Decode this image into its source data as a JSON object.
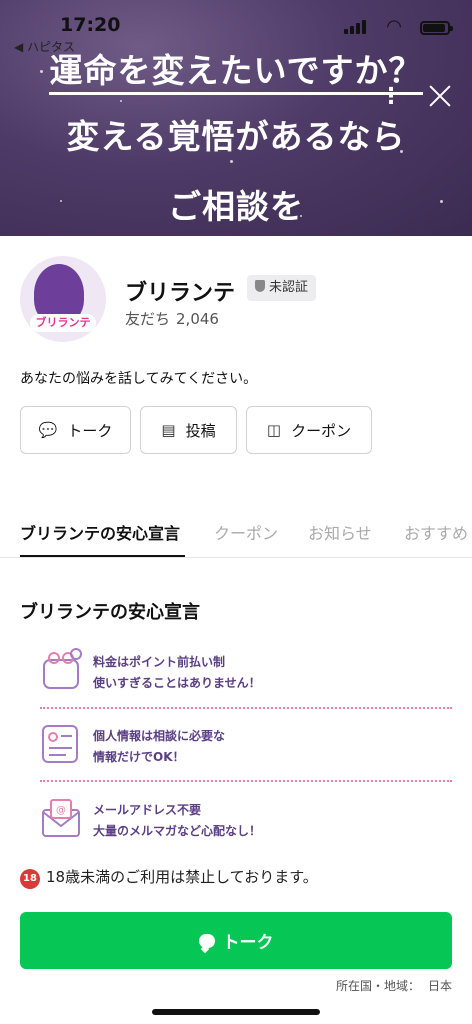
{
  "status_bar": {
    "time": "17:20",
    "back_label": "◀ ハピタス"
  },
  "hero": {
    "line1": "運命を変えたいですか？",
    "line2": "変える覚悟があるなら",
    "line3": "ご相談を",
    "more_icon": "more-vertical-icon",
    "close_icon": "close-icon"
  },
  "profile": {
    "avatar_label": "ブリランテ",
    "name": "ブリランテ",
    "badge": "未認証",
    "friends_label": "友だち",
    "friends_count": "2,046",
    "intro": "あなたの悩みを話してみてください。"
  },
  "actions": [
    {
      "label": "トーク",
      "icon": "chat-bubble-icon"
    },
    {
      "label": "投稿",
      "icon": "document-icon"
    },
    {
      "label": "クーポン",
      "icon": "coupon-icon"
    }
  ],
  "tabs": [
    {
      "label": "ブリランテの安心宣言",
      "active": true
    },
    {
      "label": "クーポン",
      "active": false
    },
    {
      "label": "お知らせ",
      "active": false
    },
    {
      "label": "おすすめ",
      "active": false
    }
  ],
  "section": {
    "title": "ブリランテの安心宣言",
    "features": [
      {
        "icon": "coin-purse-icon",
        "line1": "料金はポイント前払い制",
        "line2": "使いすぎることはありません！"
      },
      {
        "icon": "id-document-icon",
        "line1": "個人情報は相談に必要な",
        "line2": "情報だけでOK！"
      },
      {
        "icon": "envelope-icon",
        "line1": "メールアドレス不要",
        "line2": "大量のメルマガなど心配なし！"
      }
    ]
  },
  "notice": {
    "icon_text": "18",
    "text": "18歳未満のご利用は禁止しております。"
  },
  "cta": {
    "label": "トーク"
  },
  "location": {
    "label": "所在国・地域：",
    "value": "日本"
  },
  "colors": {
    "line_green": "#06c755",
    "feature_purple": "#5b3f86",
    "divider_pink": "#e77fae"
  }
}
